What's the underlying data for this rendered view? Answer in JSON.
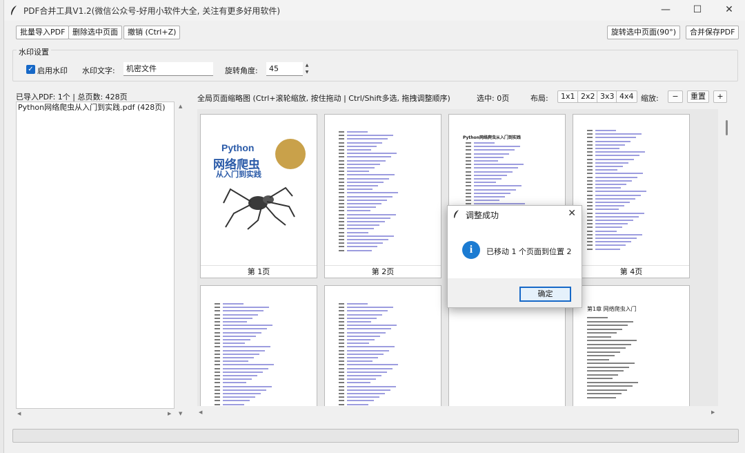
{
  "window": {
    "title": "PDF合并工具V1.2(微信公众号-好用小软件大全, 关注有更多好用软件)",
    "minimize": "—",
    "maximize": "☐",
    "close": "✕"
  },
  "toolbar": {
    "batch_import": "批量导入PDF",
    "delete_selected": "删除选中页面",
    "undo": "撤销 (Ctrl+Z)",
    "rotate_selected": "旋转选中页面(90°)",
    "merge_save": "合并保存PDF"
  },
  "watermark": {
    "group_label": "水印设置",
    "enable_label": "启用水印",
    "enabled": true,
    "text_label": "水印文字:",
    "text_value": "机密文件",
    "angle_label": "旋转角度:",
    "angle_value": "45"
  },
  "left_panel": {
    "info": "已导入PDF: 1个 | 总页数: 428页",
    "files": [
      "Python网络爬虫从入门到实践.pdf (428页)"
    ]
  },
  "right_panel": {
    "hint": "全局页面缩略图 (Ctrl+滚轮缩放, 按住拖动 | Ctrl/Shift多选, 拖拽调整顺序)",
    "selected": "选中: 0页",
    "layout_label": "布局:",
    "layouts": [
      "1x1",
      "2x2",
      "3x3",
      "4x4"
    ],
    "zoom_label": "缩放:",
    "zoom_out": "−",
    "zoom_reset": "重置",
    "zoom_in": "+"
  },
  "thumbnails": {
    "labels": [
      "第 1页",
      "第 2页",
      "",
      "第 4页"
    ],
    "cover": {
      "title": "Python",
      "subtitle": "网络爬虫",
      "subtitle2": "从入门到实践"
    },
    "page3_title": "Python网络爬虫从入门到实践",
    "chapter_heading": "第1章   网络爬虫入门"
  },
  "dialog": {
    "title": "调整成功",
    "close": "✕",
    "message": "已移动 1 个页面到位置 2",
    "ok": "确定"
  }
}
